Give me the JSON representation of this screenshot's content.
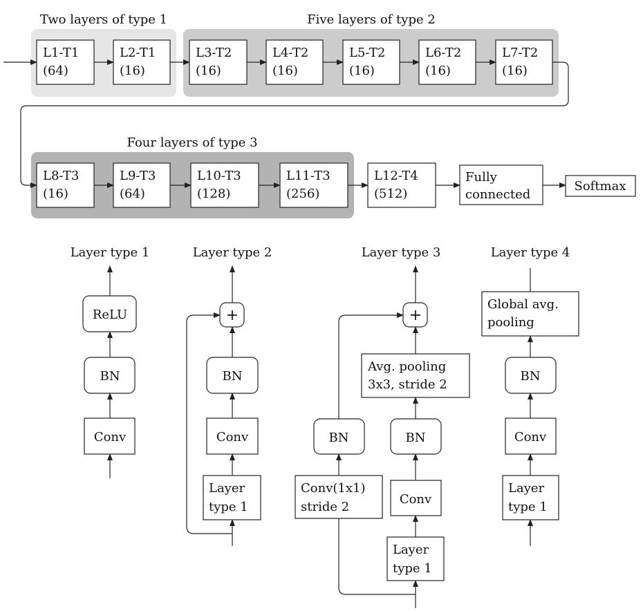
{
  "groups": {
    "g1": "Two layers of type 1",
    "g2": "Five layers of type 2",
    "g3": "Four layers of type 3"
  },
  "colors": {
    "group1": "#e6e6e6",
    "group2": "#cccccc",
    "group3": "#b3b3b3"
  },
  "layers": [
    [
      "L1-T1",
      "(64)"
    ],
    [
      "L2-T1",
      "(16)"
    ],
    [
      "L3-T2",
      "(16)"
    ],
    [
      "L4-T2",
      "(16)"
    ],
    [
      "L5-T2",
      "(16)"
    ],
    [
      "L6-T2",
      "(16)"
    ],
    [
      "L7-T2",
      "(16)"
    ],
    [
      "L8-T3",
      "(16)"
    ],
    [
      "L9-T3",
      "(64)"
    ],
    [
      "L10-T3",
      "(128)"
    ],
    [
      "L11-T3",
      "(256)"
    ],
    [
      "L12-T4",
      "(512)"
    ]
  ],
  "fc": [
    "Fully",
    "connected"
  ],
  "softmax": "Softmax",
  "types": {
    "t1": {
      "title": "Layer type 1",
      "relu": "ReLU",
      "bn": "BN",
      "conv": "Conv"
    },
    "t2": {
      "title": "Layer type 2",
      "plus": "+",
      "bn": "BN",
      "conv": "Conv",
      "input": [
        "Layer",
        "type 1"
      ]
    },
    "t3": {
      "title": "Layer type 3",
      "plus": "+",
      "pool": [
        "Avg. pooling",
        "3x3, stride 2"
      ],
      "bn": "BN",
      "conv": "Conv",
      "input": [
        "Layer",
        "type 1"
      ],
      "skip_bn": "BN",
      "skip_conv": [
        "Conv(1x1)",
        "stride 2"
      ]
    },
    "t4": {
      "title": "Layer type 4",
      "pool": [
        "Global avg.",
        "pooling"
      ],
      "bn": "BN",
      "conv": "Conv",
      "input": [
        "Layer",
        "type 1"
      ]
    }
  }
}
